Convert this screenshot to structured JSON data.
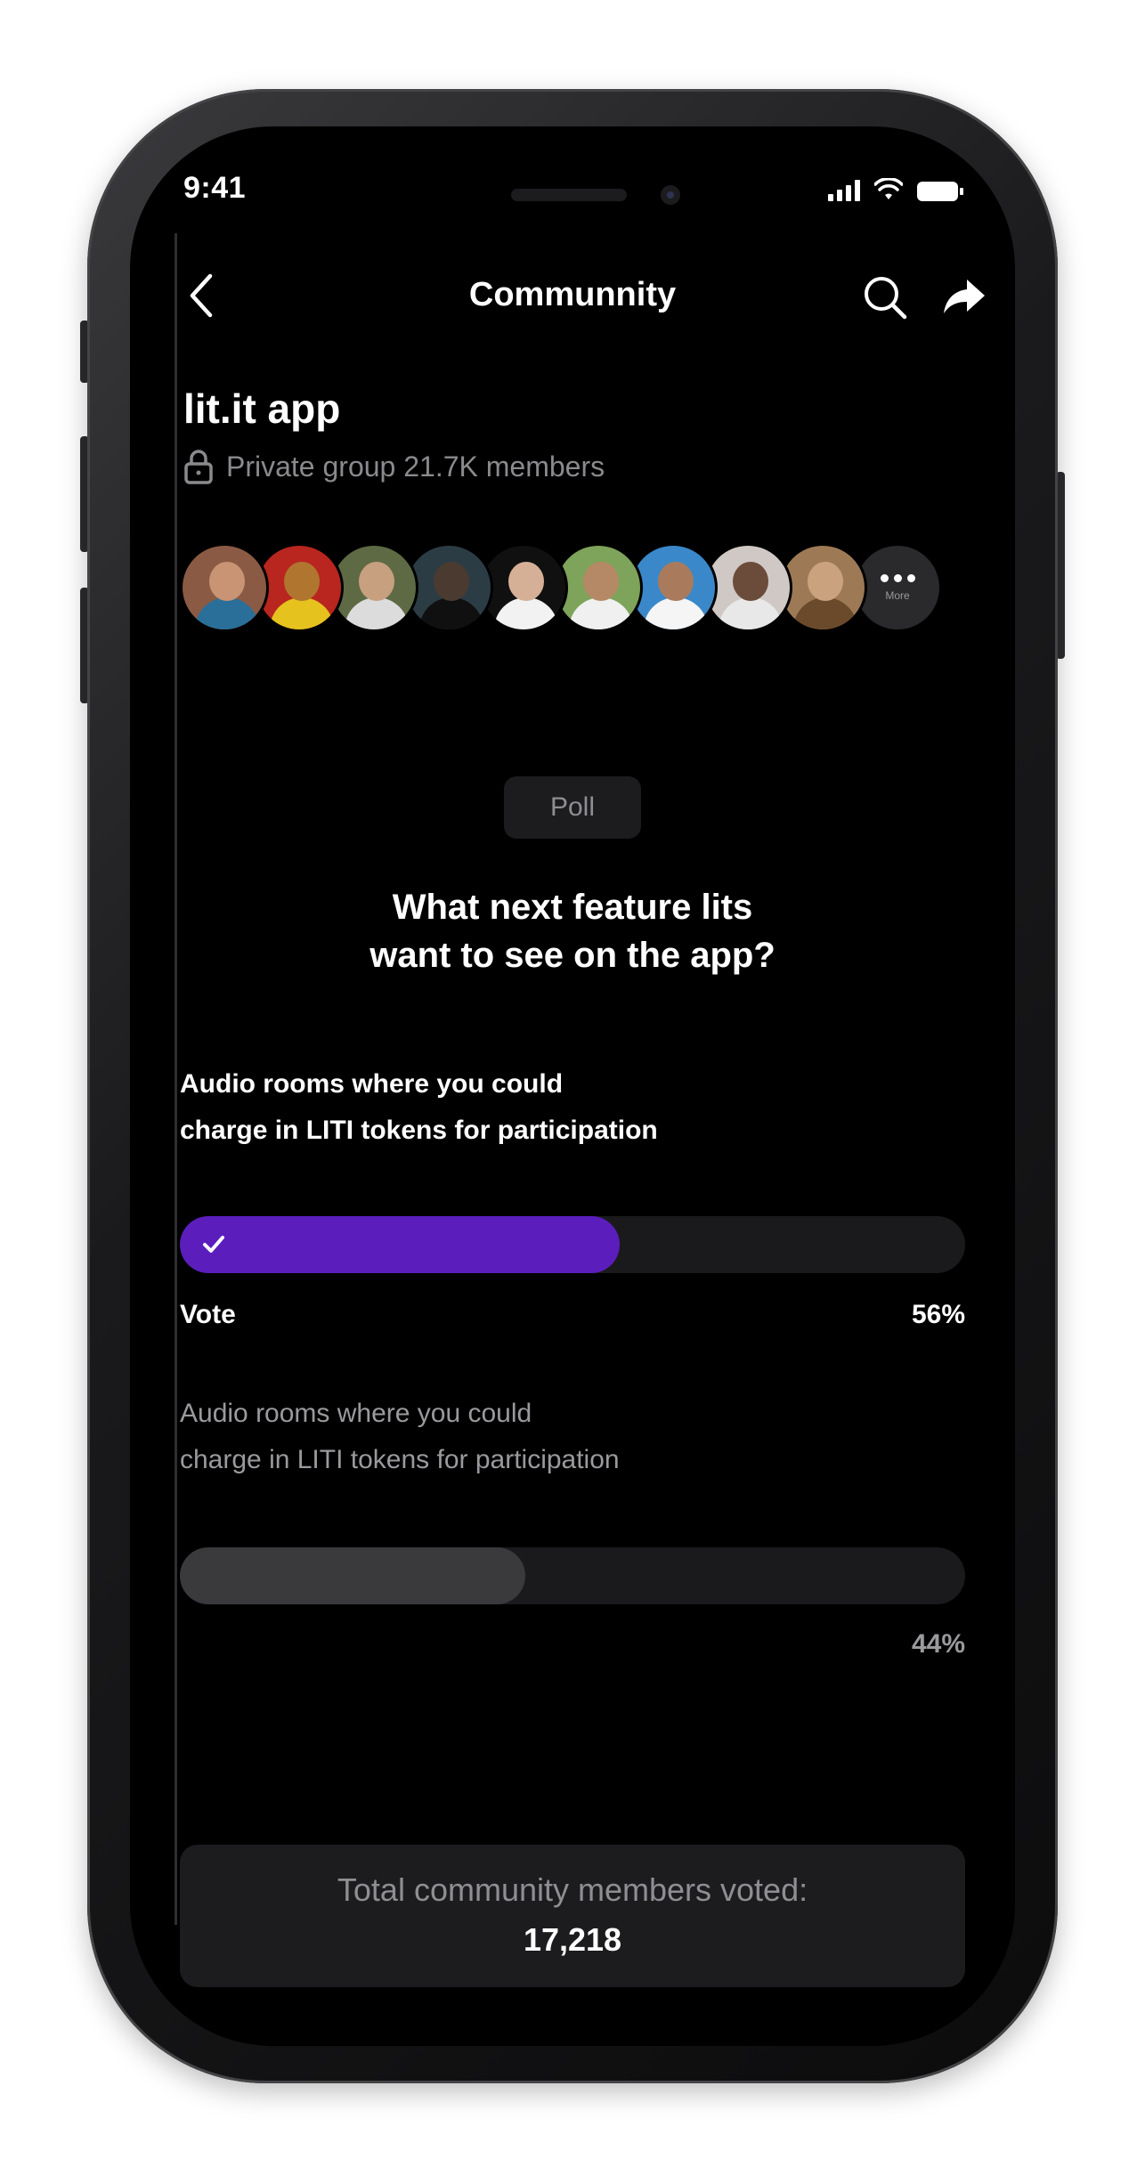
{
  "status_bar": {
    "time": "9:41"
  },
  "nav": {
    "title": "Communnity"
  },
  "group": {
    "name": "lit.it app",
    "meta": "Private group 21.7K members"
  },
  "avatars": [
    {
      "label": "member-1",
      "skin": "#c99474",
      "shirt": "#2a6f9a",
      "bg": "#8a5a44"
    },
    {
      "label": "member-2",
      "skin": "#b0762f",
      "shirt": "#e6c21e",
      "bg": "#b8261f"
    },
    {
      "label": "member-3",
      "skin": "#c7a07f",
      "shirt": "#dcdcdc",
      "bg": "#5e6a44"
    },
    {
      "label": "member-4",
      "skin": "#4a3a30",
      "shirt": "#101010",
      "bg": "#2c3c45"
    },
    {
      "label": "member-5",
      "skin": "#d6b096",
      "shirt": "#f2f2f2",
      "bg": "#101010"
    },
    {
      "label": "member-6",
      "skin": "#b58965",
      "shirt": "#f0f0f0",
      "bg": "#7ea35a"
    },
    {
      "label": "member-7",
      "skin": "#a97b5c",
      "shirt": "#f5f5f5",
      "bg": "#3a88c9"
    },
    {
      "label": "member-8",
      "skin": "#6b4b3a",
      "shirt": "#e8e8e8",
      "bg": "#d0c8c4"
    },
    {
      "label": "member-9",
      "skin": "#caa37e",
      "shirt": "#6b4a2c",
      "bg": "#9d7a55"
    }
  ],
  "avatar_more": {
    "label": "More"
  },
  "poll": {
    "badge": "Poll",
    "question": "What next feature lits\nwant to see on the app?",
    "options": [
      {
        "text": "Audio rooms where you could\ncharge in LITI tokens for participation",
        "percent_label": "56%",
        "fraction": 0.56,
        "selected": true,
        "action_label": "Vote"
      },
      {
        "text": "Audio rooms where you could\ncharge in LITI tokens for participation",
        "percent_label": "44%",
        "fraction": 0.44,
        "selected": false
      }
    ]
  },
  "total": {
    "label": "Total community members voted:",
    "value": "17,218"
  },
  "colors": {
    "accent": "#5b1ebd",
    "background": "#000000",
    "card": "#1c1c1e"
  },
  "icons": [
    "back-icon",
    "search-icon",
    "share-icon",
    "lock-icon",
    "check-icon",
    "signal-icon",
    "wifi-icon",
    "battery-icon",
    "more-dots-icon"
  ]
}
